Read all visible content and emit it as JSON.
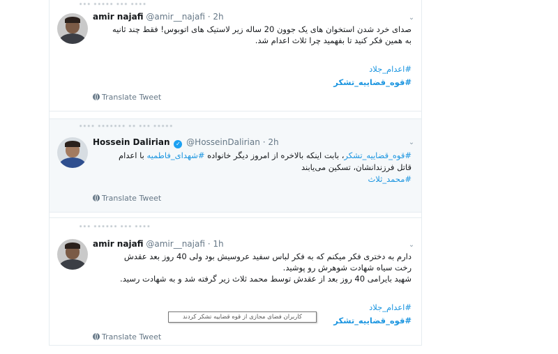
{
  "tweets": [
    {
      "context": "••• ••••• ••• ••••",
      "name": "amir najafi",
      "handle": "@amir__najafi",
      "dot": "·",
      "time": "2h",
      "lines": [
        "صدای خرد شدن استخوان های یک جوون 20 ساله زیر لاستیک های اتوبوس! فقط چند ثانیه",
        "به همین فکر کنید تا بفهمید چرا ثلاث اعدام شد."
      ],
      "hashtags": [
        "#اعدام_جلاد",
        "#قوه_قضاییه_تشکر"
      ],
      "translate": "Translate Tweet"
    },
    {
      "context": "•••• ••••••• •• ••• •••••",
      "name": "Hossein Dalirian",
      "handle": "@HosseinDalirian",
      "dot": "·",
      "time": "2h",
      "line1_tag1": "#قوه_قضاییه_تشکر",
      "line1_text1": "، بابت اینکه بالاخره از امروز دیگر خانواده ",
      "line1_tag2": "#شهدای_فاطمیه",
      "line1_text2": " با اعدام",
      "line2": "قاتل فرزندانشان، تسکین می‌یابند",
      "line3_tag": "#محمد_ثلاث",
      "translate": "Translate Tweet"
    },
    {
      "context": "••• •••••• ••• ••••",
      "name": "amir najafi",
      "handle": "@amir__najafi",
      "dot": "·",
      "time": "1h",
      "lines": [
        "دارم به دختری فکر میکنم که به فکر لباس سفید عروسیش بود ولی 40 روز بعد عقدش",
        "رخت سیاه شهادت شوهرش رو پوشید.",
        "شهید بایرامی 40 روز بعد از عقدش توسط محمد ثلاث زیر گرفته شد و به شهادت رسید."
      ],
      "hashtags": [
        "#اعدام_جلاد",
        "#قوه_قضاییه_تشکر"
      ],
      "translate": "Translate Tweet"
    }
  ],
  "tooltip": "کاربران فضای مجازی از قوه قضاییه تشکر کردند",
  "icons": {
    "caret": "chevron-down-icon",
    "globe": "globe-icon",
    "verified": "verified-badge-icon"
  },
  "colors": {
    "link": "#1b95e0",
    "muted": "#657786",
    "verified": "#1da1f2",
    "highlight_bg": "#f5f8fa"
  }
}
